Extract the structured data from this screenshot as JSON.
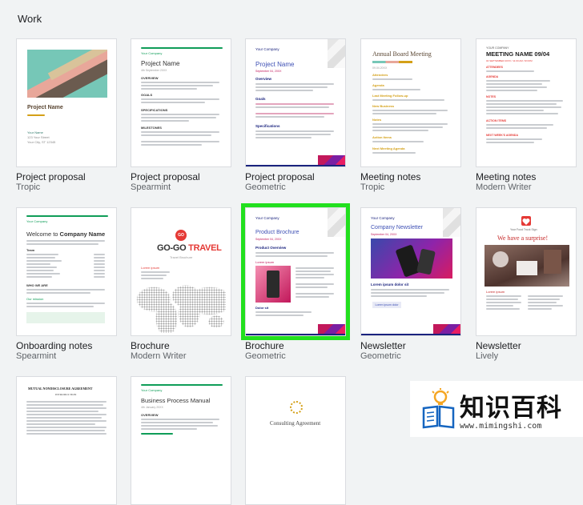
{
  "section_title": "Work",
  "templates": [
    {
      "id": "t1",
      "name": "Project proposal",
      "style": "Tropic",
      "preview": {
        "title": "Project Name",
        "sub1": "Your Name",
        "sub2": "123 Your Street",
        "sub3": "Your City, ST 12345"
      }
    },
    {
      "id": "t2",
      "name": "Project proposal",
      "style": "Spearmint",
      "preview": {
        "company": "Your Company",
        "title": "Project Name",
        "date": "4th September 20XX",
        "h1": "OVERVIEW",
        "h2": "GOALS",
        "h3": "SPECIFICATIONS",
        "h4": "MILESTONES"
      }
    },
    {
      "id": "t3",
      "name": "Project proposal",
      "style": "Geometric",
      "preview": {
        "company": "Your Company",
        "title": "Project Name",
        "date": "September 04, 20XX",
        "h1": "Overview",
        "h2": "Goals",
        "h3": "Specifications"
      }
    },
    {
      "id": "t4",
      "name": "Meeting notes",
      "style": "Tropic",
      "preview": {
        "title": "Annual Board Meeting",
        "date": "09.04.20XX",
        "h1": "Attendees",
        "h2": "Agenda",
        "h3": "Last Meeting Follow-up",
        "h4": "New Business",
        "h5": "Notes",
        "h6": "Action Items",
        "h7": "Next Meeting Agenda"
      }
    },
    {
      "id": "t5",
      "name": "Meeting notes",
      "style": "Modern Writer",
      "preview": {
        "company": "YOUR COMPANY",
        "title": "MEETING NAME 09/04",
        "date": "04 SEPTEMBER 20XX / 11:00 AM / ROOM",
        "h1": "ATTENDEES",
        "h2": "AGENDA",
        "h3": "NOTES",
        "h4": "ACTION ITEMS",
        "h5": "NEXT WEEK'S AGENDA"
      }
    },
    {
      "id": "t6",
      "name": "Onboarding notes",
      "style": "Spearmint",
      "preview": {
        "company": "Your Company",
        "title_a": "Welcome to ",
        "title_b": "Company Name",
        "h1": "Team",
        "h2": "WHO WE ARE",
        "h3": "Our mission"
      }
    },
    {
      "id": "t7",
      "name": "Brochure",
      "style": "Modern Writer",
      "preview": {
        "badge": "GO",
        "brand_a": "GO-GO ",
        "brand_b": "TRAVEL",
        "sub": "Travel Brochure",
        "h1": "Lorem ipsum"
      }
    },
    {
      "id": "t8",
      "name": "Brochure",
      "style": "Geometric",
      "selected": true,
      "preview": {
        "company": "Your Company",
        "title": "Product Brochure",
        "date": "September 04, 20XX",
        "h1": "Product Overview",
        "h2": "Lorem ipsum",
        "h3": "Dolor sit"
      }
    },
    {
      "id": "t9",
      "name": "Newsletter",
      "style": "Geometric",
      "preview": {
        "company": "Your Company",
        "title": "Company Newsletter",
        "date": "September 04, 20XX",
        "h1": "Lorem ipsum dolor sit",
        "btn": "Lorem ipsum dolor"
      }
    },
    {
      "id": "t10",
      "name": "Newsletter",
      "style": "Lively",
      "preview": {
        "brand": "Your Food Truck Sign",
        "title": "We have a surprise!",
        "h1": "Lorem ipsum"
      }
    },
    {
      "id": "t11",
      "preview": {
        "title": "MUTUAL NONDISCLOSURE AGREEMENT",
        "sub": "INTRODUCTION"
      }
    },
    {
      "id": "t12",
      "preview": {
        "company": "Your Company",
        "title": "Business Process Manual",
        "date": "4th January 20XX",
        "h1": "OVERVIEW"
      }
    },
    {
      "id": "t13",
      "preview": {
        "title": "Consulting Agreement"
      }
    }
  ],
  "watermark": {
    "chinese": "知识百科",
    "url": "www.mimingshi.com"
  },
  "colors": {
    "selected_outline": "#22e01e",
    "geometric_accent": "#c2185b",
    "tropic_accent": "#d4a017",
    "spearmint_accent": "#0f9d58",
    "navy": "#1a237e"
  }
}
